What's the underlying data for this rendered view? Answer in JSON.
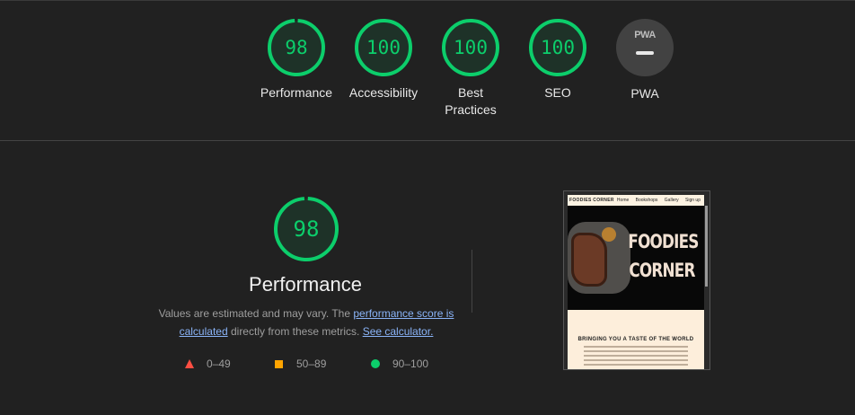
{
  "colors": {
    "pass": "#0cce6b",
    "average": "#ffa400",
    "fail": "#ff4e42",
    "link": "#8ab4f8"
  },
  "summary": [
    {
      "score": "98",
      "value": 98,
      "label": "Performance"
    },
    {
      "score": "100",
      "value": 100,
      "label": "Accessibility"
    },
    {
      "score": "100",
      "value": 100,
      "label": "Best Practices"
    },
    {
      "score": "100",
      "value": 100,
      "label": "SEO"
    }
  ],
  "pwa": {
    "badge": "PWA",
    "label": "PWA"
  },
  "performance": {
    "score": "98",
    "value": 98,
    "title": "Performance",
    "desc_prefix": "Values are estimated and may vary. The ",
    "desc_link1": "performance score is calculated",
    "desc_middle": " directly from these metrics. ",
    "desc_link2": "See calculator."
  },
  "legend": [
    {
      "shape": "triangle-icon",
      "range": "0–49"
    },
    {
      "shape": "square-icon",
      "range": "50–89"
    },
    {
      "shape": "circle-icon",
      "range": "90–100"
    }
  ],
  "thumbnail": {
    "brand": "FOODIES CORNER",
    "nav_links": [
      "Home",
      "Bookshops",
      "Gallery",
      "Sign up"
    ],
    "hero_line1": "FOODIES",
    "hero_line2": "CORNER",
    "heading": "BRINGING YOU A TASTE OF THE WORLD"
  }
}
